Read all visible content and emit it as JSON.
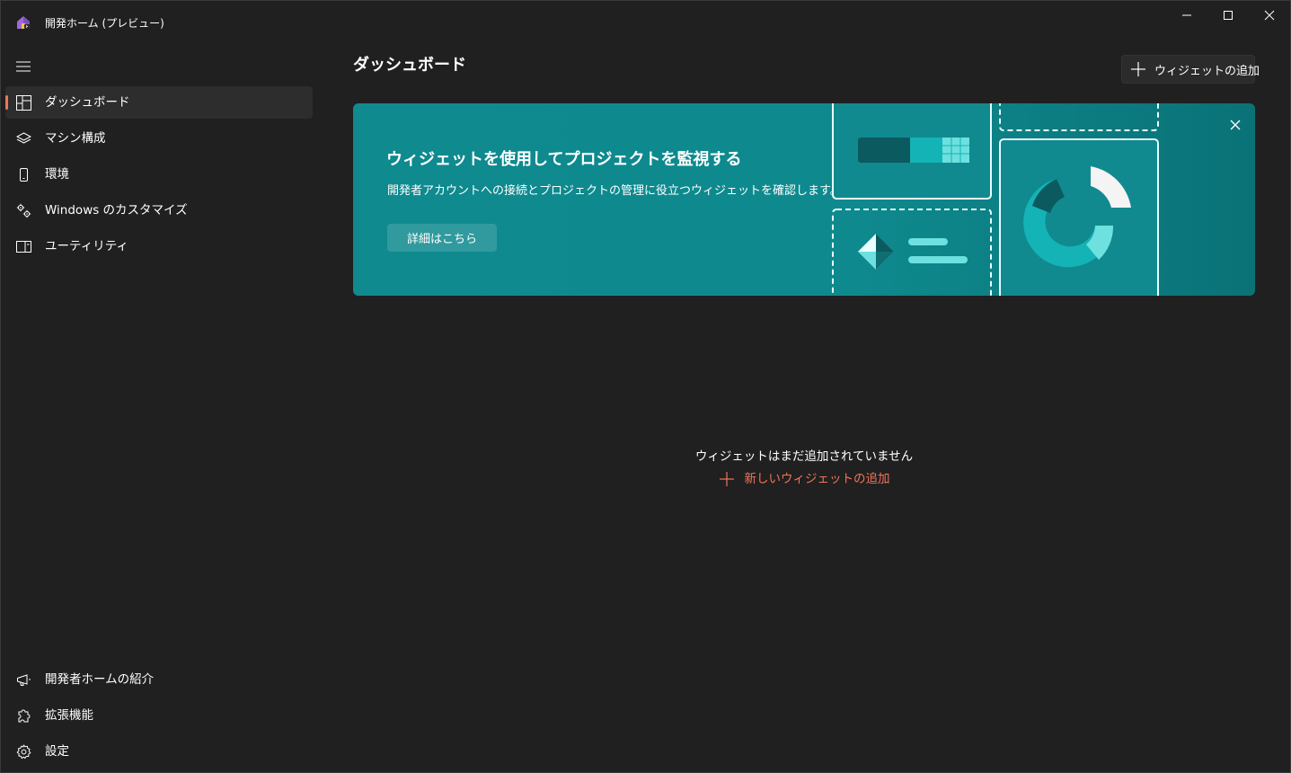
{
  "window": {
    "title": "開発ホーム (プレビュー)",
    "app_icon": "dev-home-icon",
    "controls": [
      "minimize-icon",
      "maximize-icon",
      "close-icon"
    ]
  },
  "sidebar": {
    "menu_icon": "hamburger-icon",
    "items": [
      {
        "label": "ダッシュボード",
        "icon": "dashboard-icon",
        "selected": true
      },
      {
        "label": "マシン構成",
        "icon": "layers-icon"
      },
      {
        "label": "環境",
        "icon": "phone-device-icon"
      },
      {
        "label": "Windows のカスタマイズ",
        "icon": "gears-icon"
      },
      {
        "label": "ユーティリティ",
        "icon": "panel-icon"
      }
    ],
    "footer_items": [
      {
        "label": "開発者ホームの紹介",
        "icon": "megaphone-icon"
      },
      {
        "label": "拡張機能",
        "icon": "puzzle-icon"
      },
      {
        "label": "設定",
        "icon": "gear-icon"
      }
    ]
  },
  "main": {
    "title": "ダッシュボード",
    "add_widget_label": "ウィジェットの追加",
    "banner": {
      "title": "ウィジェットを使用してプロジェクトを監視する",
      "description": "開発者アカウントへの接続とプロジェクトの管理に役立つウィジェットを確認します。",
      "button_label": "詳細はこちら"
    },
    "empty_state": {
      "message": "ウィジェットはまだ追加されていません",
      "add_label": "新しいウィジェットの追加"
    }
  },
  "colors": {
    "background": "#202020",
    "accent": "#f0745a",
    "banner": "#0f8a8f",
    "selected_item": "#2d2d2d"
  }
}
